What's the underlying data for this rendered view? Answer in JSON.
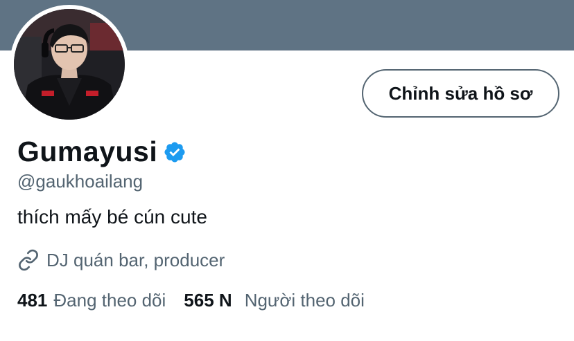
{
  "profile": {
    "display_name": "Gumayusi",
    "handle": "@gaukhoailang",
    "bio": "thích mấy bé cún cute",
    "link_text": "DJ quán bar, producer",
    "verified": true
  },
  "actions": {
    "edit_profile_label": "Chỉnh sửa hồ sơ"
  },
  "stats": {
    "following_count": "481",
    "following_label": "Đang theo dõi",
    "followers_count": "565 N",
    "followers_label": "Người theo dõi"
  },
  "icons": {
    "verified": "verified-badge-icon",
    "link": "link-icon"
  },
  "colors": {
    "banner": "#5f7384",
    "verified_blue": "#1d9bf0",
    "secondary_text": "#536471",
    "primary_text": "#0f1419"
  }
}
